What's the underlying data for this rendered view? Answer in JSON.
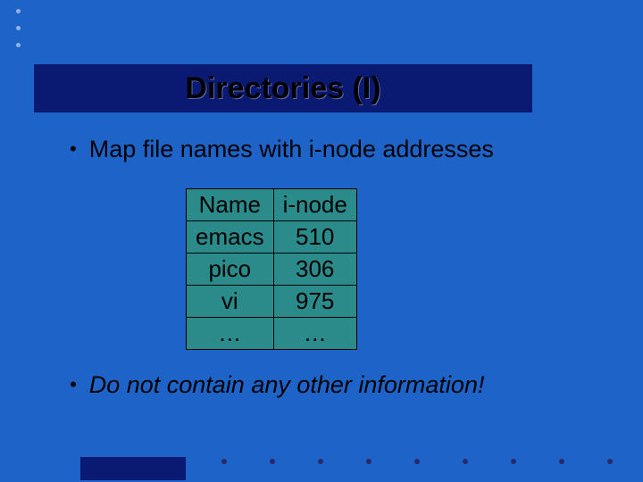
{
  "title": "Directories (I)",
  "bullets": {
    "first": "Map file names with i-node addresses",
    "second": "Do not contain any other information!"
  },
  "table": {
    "header": {
      "col1": "Name",
      "col2": "i-node"
    },
    "rows": [
      {
        "col1": "emacs",
        "col2": "510"
      },
      {
        "col1": "pico",
        "col2": "306"
      },
      {
        "col1": "vi",
        "col2": "975"
      },
      {
        "col1": "…",
        "col2": "…"
      }
    ]
  }
}
